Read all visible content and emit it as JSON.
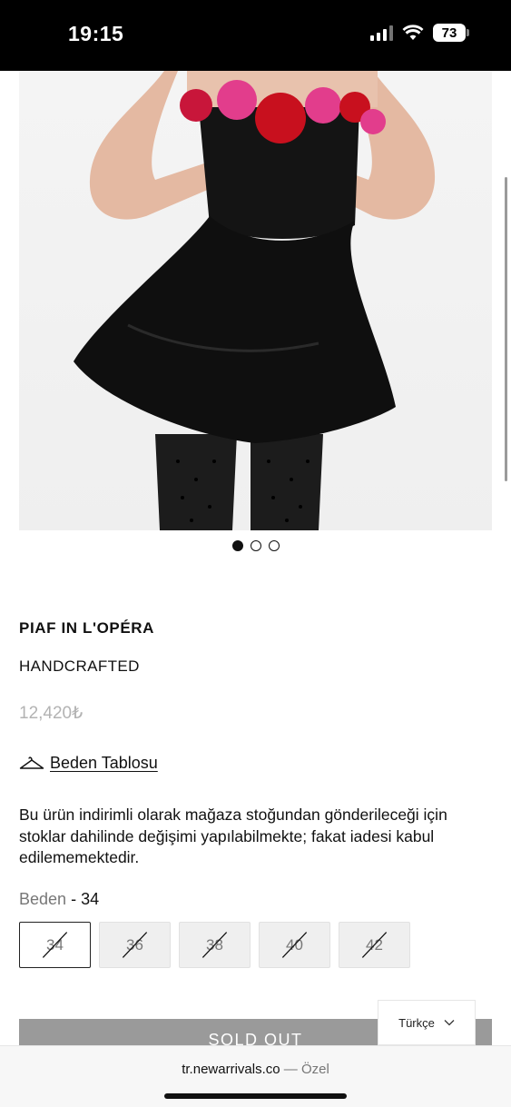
{
  "status_bar": {
    "time": "19:15",
    "battery": "73"
  },
  "product": {
    "title": "PIAF IN L'OPÉRA",
    "subtitle": "HANDCRAFTED",
    "price": "12,420₺",
    "size_chart_label": "Beden Tablosu",
    "notice": "Bu ürün indirimli olarak mağaza stoğundan gönderileceği için stoklar dahilinde değişimi yapılabilmekte; fakat iadesi kabul edilememektedir.",
    "size_field_label": "Beden",
    "selected_size": "- 34",
    "sizes": [
      "34",
      "36",
      "38",
      "40",
      "42"
    ],
    "sold_out_label": "SOLD OUT"
  },
  "carousel": {
    "total": 3,
    "active": 1
  },
  "language_selector": {
    "value": "Türkçe"
  },
  "browser": {
    "url": "tr.newarrivals.co",
    "separator": "—",
    "mode": "Özel"
  },
  "colors": {
    "price": "#b3b3b3",
    "sold_out_bg": "#9a9a9a",
    "size_bg": "#efefef"
  }
}
